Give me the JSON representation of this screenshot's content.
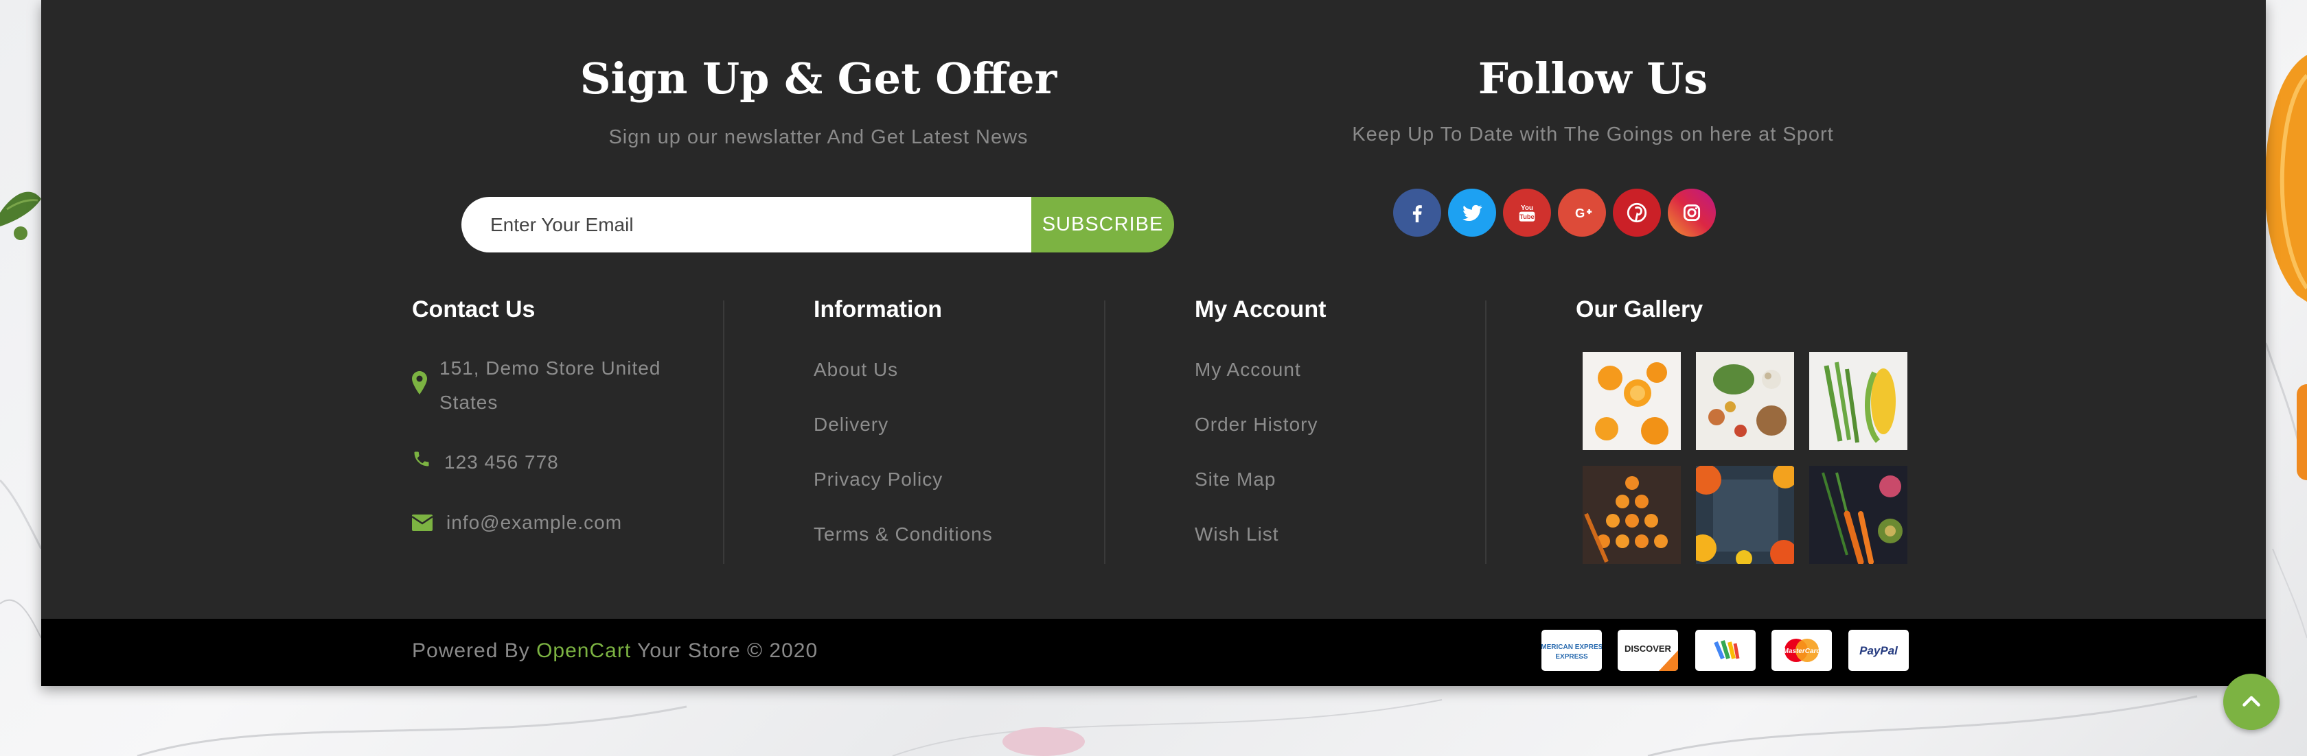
{
  "newsletter": {
    "title": "Sign Up & Get Offer",
    "subtitle": "Sign up our newslatter And Get Latest News",
    "email_placeholder": "Enter Your Email",
    "subscribe_label": "SUBSCRIBE"
  },
  "follow": {
    "title": "Follow Us",
    "subtitle": "Keep Up To Date with The Goings on here at Sport",
    "socials": [
      {
        "icon": "facebook-icon",
        "color": "#3b5998"
      },
      {
        "icon": "twitter-icon",
        "color": "#1da1f2"
      },
      {
        "icon": "youtube-icon",
        "color": "#d0312d"
      },
      {
        "icon": "google-plus-icon",
        "color": "#dd4b39"
      },
      {
        "icon": "pinterest-icon",
        "color": "#cb2027"
      },
      {
        "icon": "instagram-icon",
        "color": "#d6249f"
      }
    ]
  },
  "contact": {
    "title": "Contact Us",
    "address": "151, Demo Store United States",
    "phone": "123 456 778",
    "email": "info@example.com"
  },
  "information": {
    "title": "Information",
    "links": [
      "About Us",
      "Delivery",
      "Privacy Policy",
      "Terms & Conditions"
    ]
  },
  "account": {
    "title": "My Account",
    "links": [
      "My Account",
      "Order History",
      "Site Map",
      "Wish List"
    ]
  },
  "gallery": {
    "title": "Our Gallery"
  },
  "bottom": {
    "powered_prefix": "Powered By",
    "opencart": "OpenCart",
    "suffix": "Your Store © 2020",
    "payments": [
      "AMERICAN EXPRESS",
      "DISCOVER",
      "Google Wallet",
      "MasterCard",
      "PayPal"
    ]
  },
  "colors": {
    "accent": "#7cb342",
    "footer_bg": "#282828",
    "bottom_bg": "#000000"
  }
}
